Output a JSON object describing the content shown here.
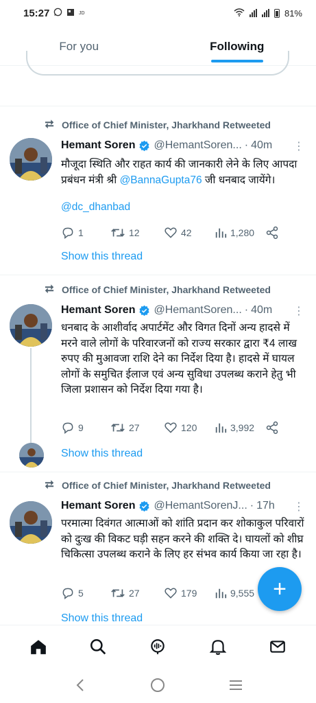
{
  "status_bar": {
    "time": "15:27",
    "battery": "81%"
  },
  "tabs": [
    {
      "label": "For you",
      "active": false
    },
    {
      "label": "Following",
      "active": true
    }
  ],
  "colors": {
    "accent": "#1d9bf0",
    "text_secondary": "#536471"
  },
  "tweets": [
    {
      "retweeted_by": "Office of Chief Minister, Jharkhand Retweeted",
      "author": "Hemant Soren",
      "handle": "@HemantSoren...",
      "time": "40m",
      "text_parts": [
        "मौजूदा स्थिति और राहत कार्य की जानकारी लेने के लिए आपदा प्रबंधन मंत्री श्री ",
        "@BannaGupta76",
        " जी धनबाद जायेंगे।"
      ],
      "mention_line": "@dc_dhanbad",
      "replies": "1",
      "retweets": "12",
      "likes": "42",
      "views": "1,280",
      "show_thread": "Show this thread"
    },
    {
      "retweeted_by": "Office of Chief Minister, Jharkhand Retweeted",
      "author": "Hemant Soren",
      "handle": "@HemantSoren...",
      "time": "40m",
      "text": "धनबाद के आशीर्वाद अपार्टमेंट और विगत दिनों अन्य हादसे में मरने वाले लोगों के परिवारजनों को राज्य सरकार द्वारा ₹4 लाख रुपए की मुआवजा राशि देने का निर्देश दिया है। हादसे में घायल लोगों के समुचित ईलाज एवं अन्य सुविधा उपलब्ध कराने हेतु भी जिला प्रशासन को निर्देश दिया गया है।",
      "replies": "9",
      "retweets": "27",
      "likes": "120",
      "views": "3,992",
      "show_thread": "Show this thread"
    },
    {
      "retweeted_by": "Office of Chief Minister, Jharkhand Retweeted",
      "author": "Hemant Soren",
      "handle": "@HemantSorenJ...",
      "time": "17h",
      "text": "परमात्मा दिवंगत आत्माओं को शांति प्रदान कर शोकाकुल परिवारों को दुःख की विकट घड़ी सहन करने की शक्ति दे। घायलों को शीघ्र चिकित्सा उपलब्ध कराने के लिए हर संभव कार्य किया जा रहा है।",
      "replies": "5",
      "retweets": "27",
      "likes": "179",
      "views": "9,555",
      "show_thread": "Show this thread"
    }
  ],
  "fab": {
    "icon": "plus-icon",
    "label": "+"
  },
  "bottom_nav": [
    "home-icon",
    "search-icon",
    "spaces-icon",
    "notifications-icon",
    "messages-icon"
  ],
  "system_nav": [
    "back-icon",
    "home-circle-icon",
    "recents-icon"
  ]
}
